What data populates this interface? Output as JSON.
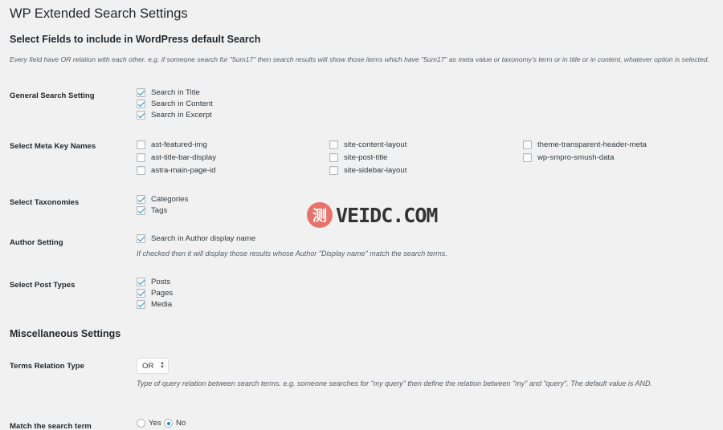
{
  "page": {
    "title": "WP Extended Search Settings",
    "section1_title": "Select Fields to include in WordPress default Search",
    "note": "Every field have OR relation with each other. e.g. if someone search for \"5um17\" then search results will show those items which have \"5um17\" as meta value or taxonomy's term or in title or in content, whatever option is selected."
  },
  "general": {
    "label": "General Search Setting",
    "options": [
      {
        "label": "Search in Title",
        "checked": true
      },
      {
        "label": "Search in Content",
        "checked": true
      },
      {
        "label": "Search in Excerpt",
        "checked": true
      }
    ]
  },
  "meta": {
    "label": "Select Meta Key Names",
    "keys": [
      "ast-featured-img",
      "ast-title-bar-display",
      "astra-main-page-id",
      "site-content-layout",
      "site-post-title",
      "site-sidebar-layout",
      "theme-transparent-header-meta",
      "wp-smpro-smush-data"
    ]
  },
  "taxonomies": {
    "label": "Select Taxonomies",
    "options": [
      {
        "label": "Categories",
        "checked": true
      },
      {
        "label": "Tags",
        "checked": true
      }
    ]
  },
  "author": {
    "label": "Author Setting",
    "option": "Search in Author display name",
    "description": "If checked then it will display those results whose Author \"Display name\" match the search terms."
  },
  "post_types": {
    "label": "Select Post Types",
    "options": [
      {
        "label": "Posts",
        "checked": true
      },
      {
        "label": "Pages",
        "checked": true
      },
      {
        "label": "Media",
        "checked": true
      }
    ]
  },
  "misc": {
    "title": "Miscellaneous Settings",
    "terms_relation_label": "Terms Relation Type",
    "terms_relation_value": "OR",
    "terms_relation_desc": "Type of query relation between search terms. e.g. someone searches for \"my query\" then define the relation between \"my\" and \"query\". The default value is AND.",
    "match_label": "Match the search term",
    "match_yes": "Yes",
    "match_no": "No",
    "match_selected": "No"
  },
  "watermark": {
    "seal": "测",
    "text": "VEIDC.COM"
  },
  "colors": {
    "checkmark": "#1e8cbe",
    "background": "#f1f1f1"
  }
}
